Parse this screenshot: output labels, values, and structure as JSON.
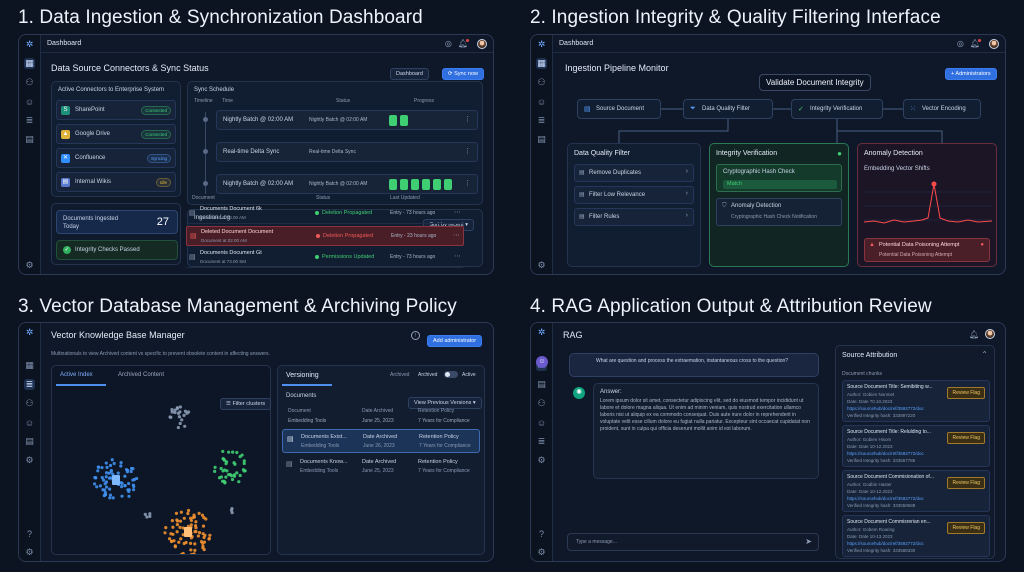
{
  "headings": {
    "p1": "1. Data Ingestion & Synchronization Dashboard",
    "p2": "2. Ingestion Integrity & Quality Filtering Interface",
    "p3": "3. Vector Database Management & Archiving Policy",
    "p4": "4. RAG Application Output & Attribution Review"
  },
  "p1": {
    "breadcrumb": "Dashboard",
    "title": "Data Source Connectors & Sync Status",
    "btn_dashboard": "Dashboard",
    "btn_sync": "Sync now",
    "connectors_title": "Active Connectors to Enterprise System",
    "connectors": [
      {
        "name": "SharePoint",
        "status": "Connected",
        "color": "#3fcf72"
      },
      {
        "name": "Google Drive",
        "status": "Connected",
        "color": "#3fcf72"
      },
      {
        "name": "Confluence",
        "status": "Syncing",
        "color": "#5aa0ff"
      },
      {
        "name": "Internal Wikis",
        "status": "Idle",
        "color": "#e0b23a"
      }
    ],
    "docs_label": "Documents Ingested Today",
    "docs_count": "27",
    "integrity_label": "Integrity Checks Passed",
    "schedule_title": "Sync Schedule",
    "schedule_cols": [
      "Timeline",
      "Time",
      "Status",
      "Progress"
    ],
    "schedule": [
      {
        "time": "Nightly Batch @ 02:00 AM",
        "status": "Nightly Batch @ 02:00 AM",
        "bars": 2
      },
      {
        "time": "Real-time Delta Sync",
        "status": "Real-time Delta Sync",
        "bars": 0
      },
      {
        "time": "Nightly Batch @ 02:00 AM",
        "status": "Nightly Batch @ 02:00 AM",
        "bars": 6
      }
    ],
    "log_title": "Ingestion Log",
    "log_filter": "Sort by recent",
    "log_cols": [
      "Document",
      "Status",
      "Last Updated"
    ],
    "log": [
      {
        "doc": "Documents Document 6k",
        "sub": "Document at 73.00 AM",
        "status": "Deletion Propagated",
        "updated": "Entry - 73 hours ago",
        "state": "ok"
      },
      {
        "doc": "Deleted Document Document",
        "sub": "Document at 02.00 AM",
        "status": "Deletion Propagated",
        "updated": "Entry - 23 hours ago",
        "state": "err"
      },
      {
        "doc": "Documents Document Gt",
        "sub": "Document at 73.00 SM",
        "status": "Permissions Updated",
        "updated": "Entry - 73 hours ago",
        "state": "ok"
      }
    ]
  },
  "p2": {
    "breadcrumb": "Dashboard",
    "title": "Ingestion Pipeline Monitor",
    "btn": "+ Administrators",
    "tooltip": "Validate Document Integrity",
    "pipeline": [
      "Source Document",
      "Data Quality Filter",
      "Integrity Verification",
      "Vector Encoding"
    ],
    "dq_title": "Data Quality Filter",
    "dq_items": [
      "Remove Duplicates",
      "Filter Low Relevance",
      "Filter Rules"
    ],
    "iv_title": "Integrity Verification",
    "iv_hash_title": "Cryptographic Hash Check",
    "iv_match": "Match",
    "iv_anom_title": "Anomaly Detection",
    "iv_anom_sub": "Cryptographic Hash Check Notification",
    "ad_title": "Anomaly Detection",
    "ad_sub": "Embedding Vector Shifts",
    "ad_alert": "Potential Data Poisoning Attempt",
    "ad_alert_sub": "Potential Data Poisoning Attempt"
  },
  "p3": {
    "title": "Vector Knowledge Base Manager",
    "btn": "Add administrator",
    "desc": "Multinationals to view Archived content vs specific to prevent obsolete content in affecting answers.",
    "tab_active": "Active Index",
    "tab_archived": "Archived Content",
    "filter": "Filter clusters",
    "versioning": "Versioning",
    "toggle_left": "Archived",
    "toggle_mid": "Archived",
    "toggle_right": "Active",
    "docs_title": "Documents",
    "view_prev": "View Previous Versions",
    "cols": [
      "Document",
      "Date Archived",
      "Retention Policy"
    ],
    "rows": [
      {
        "doc": "Embedding Tools",
        "date": "June 25, 2023",
        "policy": "7 Years for Compliance"
      },
      {
        "doc": "Documents Exist...",
        "sub": "Embedding Tools",
        "date": "Date Archived",
        "date2": "June 26, 2023",
        "policy": "Retention Policy",
        "policy2": "7 Years for Compliance"
      },
      {
        "doc": "Documents Know...",
        "sub": "Embedding Tools",
        "date": "Date Archived",
        "date2": "June 25, 2023",
        "policy": "Retention Policy",
        "policy2": "7 Years for Compliance"
      }
    ]
  },
  "p4": {
    "title": "RAG",
    "question": "What are question and process the extraemation, instantaneous cross to the question?",
    "answer_label": "Answer:",
    "answer": "Lorem ipsum dolor sit amet, consectetur adipiscing elit, sed do eiusmod tempor incididunt ut labore et dolore magna aliqua. Ut enim ad minim veniam, quis nostrud exercitation ullamco laboris nisi ut aliquip ex ea commodo consequat. Duis aute irure dolor in reprehenderit in voluptate velit esse cillum dolore eu fugiat nulla pariatur. Excepteur sint occaecat cupidatat non proident, sunt in culpa qui officia deserunt mollit anim id est laborum.",
    "input_placeholder": "Type a message...",
    "attr_title": "Source Attribution",
    "chunks_label": "Document chunks",
    "chunks": [
      {
        "title": "Source Document Title: Semibiting w...",
        "author": "Author: Gobien Nonmet",
        "date": "Date: Date 70.10.2023",
        "link": "https://sourcehub/doc/ref/3592772/doc",
        "hash": "Verified Integrity hash: 333897220"
      },
      {
        "title": "Source Document Title: Relulding to...",
        "author": "Author: Gobien Hisom",
        "date": "Date: Date 10-12.2023",
        "link": "https://sourcehub/doc/ref/3592772/doc",
        "hash": "Verified Integrity hash: 333567786"
      },
      {
        "title": "Source Document Commisionation of...",
        "author": "Author: Godbin Haster",
        "date": "Date: Date 10-12.2023",
        "link": "https://sourcehub/doc/ref/3592772/doc",
        "hash": "Verified Integrity hash: 333558588"
      },
      {
        "title": "Source Document Commisrerian en...",
        "author": "Author: Gobem Roaring",
        "date": "Date: Date 10-13.2023",
        "link": "https://sourcehub/doc/ref/3592772/doc",
        "hash": "Verified Integrity hash: 333588330"
      }
    ],
    "review_flag": "Review Flag"
  }
}
